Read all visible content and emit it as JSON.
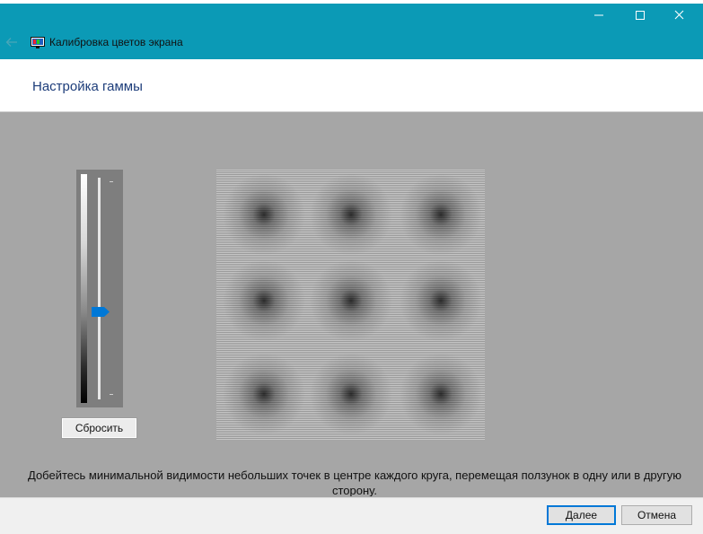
{
  "window": {
    "title": "Калибровка цветов экрана",
    "accent_color": "#0b9ab6",
    "icons": [
      "back-arrow-icon",
      "display-calibration-icon",
      "minimize-icon",
      "maximize-icon",
      "close-icon"
    ]
  },
  "page": {
    "title": "Настройка гаммы",
    "instruction": "Добейтесь минимальной видимости небольших точек в центре каждого круга, перемещая ползунок в одну или в другую сторону."
  },
  "gamma_slider": {
    "level": 0.4,
    "reset_label": "Сбросить",
    "thumb_color": "#0078d7"
  },
  "footer": {
    "next_label": "Далее",
    "cancel_label": "Отмена"
  }
}
